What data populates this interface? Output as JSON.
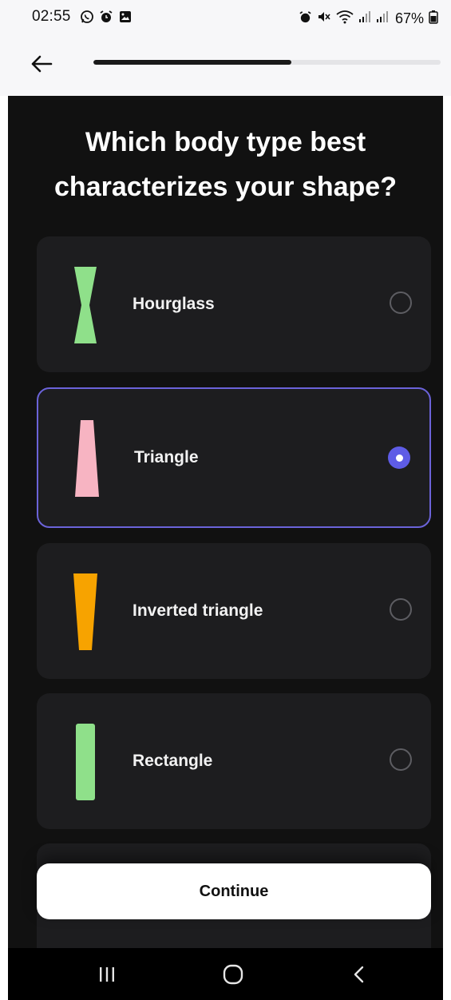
{
  "status_bar": {
    "time": "02:55",
    "battery": "67%",
    "left_icons": [
      "whatsapp-icon",
      "alarm-icon",
      "gallery-icon"
    ],
    "right_icons": [
      "alarm-icon",
      "mute-icon",
      "wifi-icon",
      "signal-icon",
      "signal-icon",
      "battery-icon"
    ]
  },
  "header": {
    "back_icon": "arrow-left-icon",
    "progress_percent": 57
  },
  "question": {
    "title": "Which body type best\ncharacterizes your shape?"
  },
  "options": [
    {
      "label": "Hourglass",
      "shape": "hourglass",
      "color": "#8fe08a",
      "selected": false
    },
    {
      "label": "Triangle",
      "shape": "triangle",
      "color": "#f7b4c2",
      "selected": true
    },
    {
      "label": "Inverted triangle",
      "shape": "inverted-triangle",
      "color": "#f7a300",
      "selected": false
    },
    {
      "label": "Rectangle",
      "shape": "rectangle",
      "color": "#8fe08a",
      "selected": false
    }
  ],
  "continue_button": {
    "label": "Continue"
  },
  "nav_bar": {
    "icons": [
      "recent-apps-icon",
      "home-icon",
      "back-icon"
    ]
  },
  "colors": {
    "background_dark": "#111111",
    "card": "#1d1d1f",
    "accent": "#5e5ce6",
    "selected_border": "#6b63d9"
  }
}
